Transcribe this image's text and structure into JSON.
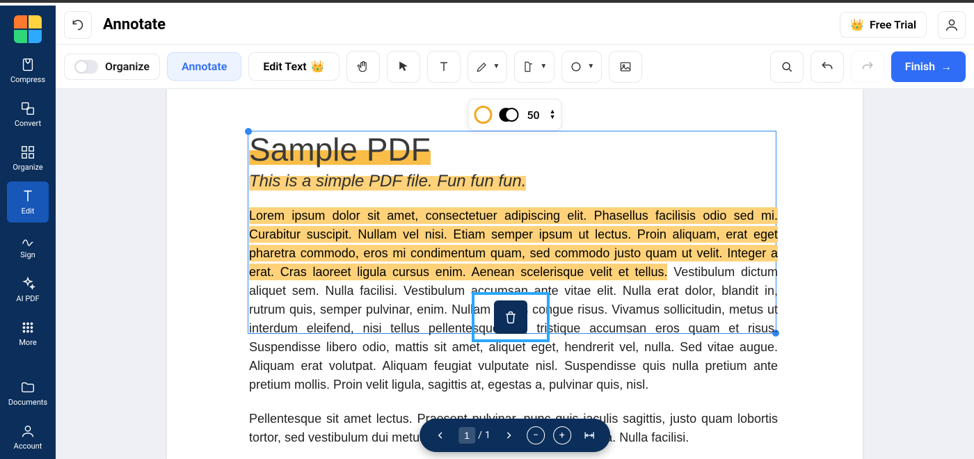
{
  "header": {
    "title": "Annotate",
    "free_trial": "Free Trial"
  },
  "sidebar": {
    "items": [
      {
        "label": "Compress"
      },
      {
        "label": "Convert"
      },
      {
        "label": "Organize"
      },
      {
        "label": "Edit"
      },
      {
        "label": "Sign"
      },
      {
        "label": "AI PDF"
      },
      {
        "label": "More"
      },
      {
        "label": "Documents"
      },
      {
        "label": "Account"
      }
    ],
    "active_index": 3
  },
  "toolbar": {
    "organize_label": "Organize",
    "annotate_label": "Annotate",
    "edit_text_label": "Edit Text",
    "finish_label": "Finish"
  },
  "style_panel": {
    "opacity_value": "50"
  },
  "document": {
    "title": "Sample PDF",
    "subtitle": "This is a simple PDF file. Fun fun fun.",
    "highlighted_body": "Lorem ipsum dolor sit amet, consectetuer adipiscing elit. Phasellus facilisis odio sed mi. Curabitur suscipit. Nullam vel nisi. Etiam semper ipsum ut lectus. Proin aliquam, erat eget pharetra commodo, eros mi condimentum quam, sed commodo justo quam ut velit. Integer a erat. Cras laoreet ligula cursus enim. Aenean scelerisque velit et tellus.",
    "body_rest_1": " Vestibulum dictum aliquet sem. Nulla facilisi. Vestibulum accumsan ante vitae elit. Nulla erat dolor, blandit in, rutrum quis, semper pulvinar, enim. Nullam varius congue risus. Vivamus sollicitudin, metus ut interdum eleifend, nisi tellus pellentesque elit, tristique accumsan eros quam et risus. Suspendisse libero odio, mattis sit amet, aliquet eget, hendrerit vel, nulla. Sed vitae augue. Aliquam erat volutpat. Aliquam feugiat vulputate nisl. Suspendisse quis nulla pretium ante pretium mollis. Proin velit ligula, sagittis at, egestas a, pulvinar quis, nisl.",
    "body_p2": "Pellentesque sit amet lectus. Praesent pulvinar, nunc quis iaculis sagittis, justo quam lobortis tortor, sed vestibulum dui metus venenatis est. Nunc cursus ligula. Nulla facilisi."
  },
  "page_nav": {
    "current": "1",
    "total": "1"
  },
  "colors": {
    "logo": [
      "#ff7a2f",
      "#ffd23f",
      "#7fd63b",
      "#2fa8ff"
    ]
  }
}
